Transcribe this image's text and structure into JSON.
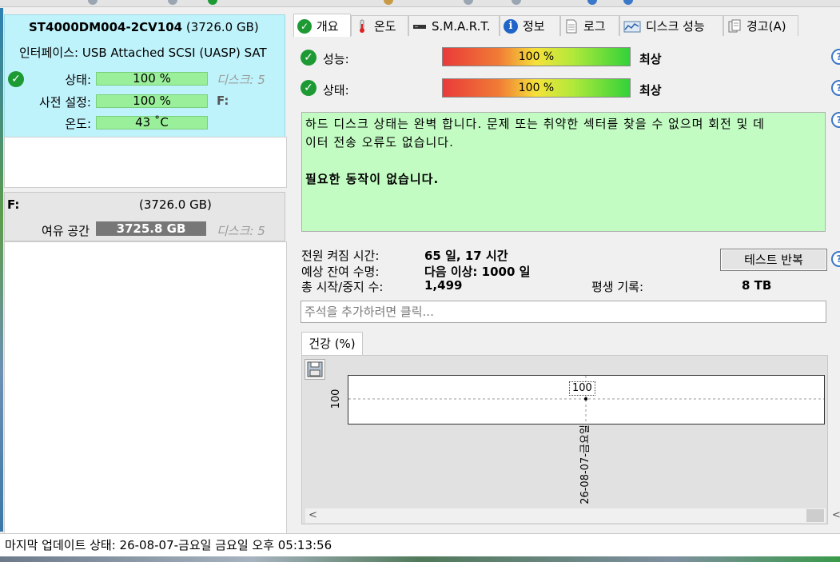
{
  "disk": {
    "model": "ST4000DM004-2CV104",
    "capacity": "(3726.0 GB)",
    "interface_label": "인터페이스:",
    "interface_value": "USB Attached SCSI (UASP) SAT",
    "status_label": "상태:",
    "status_value": "100 %",
    "presets_label": "사전 설정:",
    "presets_value": "100 %",
    "temp_label": "온도:",
    "temp_value": "43 ˚C",
    "disk_ref": "디스크: 5",
    "drive_letter": "F:"
  },
  "volume": {
    "letter": "F:",
    "capacity": "(3726.0 GB)",
    "free_label": "여유 공간",
    "free_value": "3725.8 GB",
    "disk_ref": "디스크: 5"
  },
  "tabs": [
    {
      "label": "개요",
      "icon": "check-icon"
    },
    {
      "label": "온도",
      "icon": "thermometer-icon"
    },
    {
      "label": "S.M.A.R.T.",
      "icon": "drive-icon"
    },
    {
      "label": "정보",
      "icon": "info-icon"
    },
    {
      "label": "로그",
      "icon": "document-icon"
    },
    {
      "label": "디스크 성능",
      "icon": "chart-icon"
    },
    {
      "label": "경고(A)",
      "icon": "clipboard-icon"
    }
  ],
  "overview": {
    "performance_label": "성능:",
    "performance_value": "100 %",
    "performance_rating": "최상",
    "health_label": "상태:",
    "health_value": "100 %",
    "health_rating": "최상",
    "message_line1": "하드 디스크 상태는 완벽 합니다. 문제 또는 취약한 섹터를 찾을 수 없으며 회전 및 데",
    "message_line2": "이터 전송 오류도 없습니다.",
    "message_bold": "필요한 동작이 없습니다.",
    "power_on_label": "전원 켜짐 시간:",
    "power_on_value": "65 일, 17 시간",
    "life_label": "예상 잔여 수명:",
    "life_value": "다음 이상: 1000 일",
    "starts_label": "총 시작/중지 수:",
    "starts_value": "1,499",
    "lifetime_label": "평생 기록:",
    "lifetime_value": "8 TB",
    "repeat_test_button": "테스트 반복",
    "note_placeholder": "주석을 추가하려면 클릭..."
  },
  "graph": {
    "tab_label": "건강 (%)",
    "y_tick": "100",
    "point_label": "100",
    "x_tick": "26-08-07-금요일",
    "scroll_left": "<",
    "scroll_right": "<"
  },
  "status_bar": {
    "text": "마지막 업데이트 상태: 26-08-07-금요일 금요일 오후 05:13:56"
  },
  "help_icon_glyph": "?",
  "check_glyph": "✓",
  "colors": {
    "disk_card_bg": "#bff3fb",
    "message_bg": "#c3fcc3",
    "ok_green": "#1d9a34"
  }
}
